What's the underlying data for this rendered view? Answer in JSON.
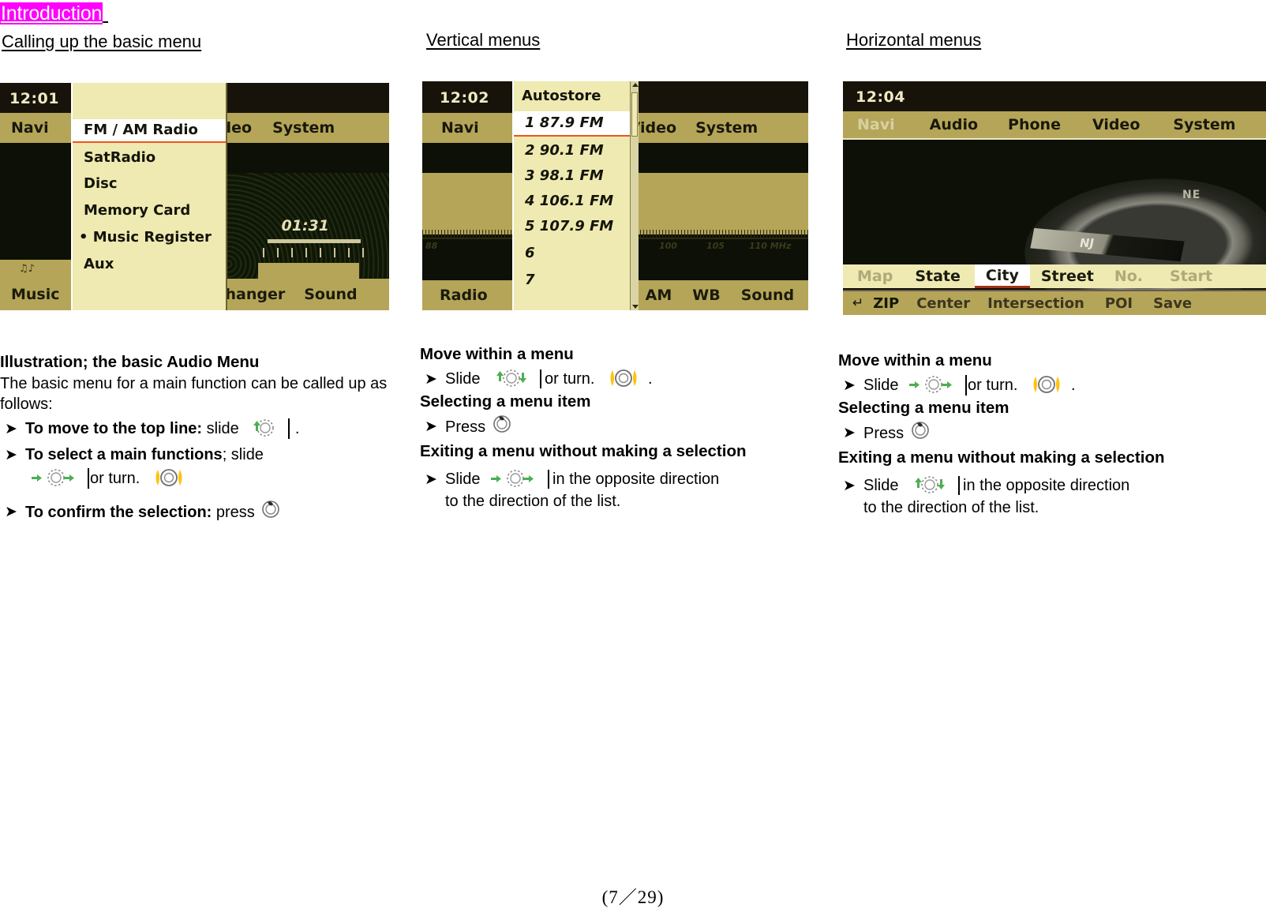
{
  "document": {
    "title": "Introduction",
    "page_number": "(7／29)"
  },
  "columns": {
    "left_heading": "Calling up the basic menu",
    "middle_heading": "Vertical menus",
    "right_heading": "Horizontal menus"
  },
  "screenshot_basic_menu": {
    "clock": "12:01",
    "menu_bar": [
      "Navi",
      "Video",
      "System"
    ],
    "dropdown_items": [
      "FM / AM Radio",
      "SatRadio",
      "Disc",
      "Memory Card",
      "• Music Register",
      "Aux"
    ],
    "selected_item": "FM / AM Radio",
    "track_time": "01:31",
    "foot_bar": [
      "Music ",
      "Changer",
      "Sound"
    ]
  },
  "screenshot_vertical_menu": {
    "clock": "12:02",
    "menu_bar": [
      "Navi",
      "Video",
      "System"
    ],
    "dropdown_title": "Autostore",
    "dropdown_items": [
      "1 87.9 FM",
      "2 90.1 FM",
      "3 98.1 FM",
      "4 106.1 FM",
      "5 107.9 FM",
      "6",
      "7"
    ],
    "selected_item": "1 87.9 FM",
    "scale_labels": [
      "88",
      "100",
      "105",
      "110 MHz"
    ],
    "foot_bar": [
      "Radio",
      "AM",
      "WB",
      "Sound"
    ]
  },
  "screenshot_horizontal_menu": {
    "clock": "12:04",
    "menu_bar": [
      "Navi",
      "Audio",
      "Phone",
      "Video",
      "System"
    ],
    "compass_labels": [
      "NE",
      "NJ"
    ],
    "tab_row": [
      "Map",
      "State",
      "City",
      "Street",
      "No.",
      "Start"
    ],
    "selected_tab": "City",
    "sub_row": [
      "ZIP",
      "Center",
      "Intersection",
      "POI",
      "Save"
    ],
    "back_icon": "back-arrow-icon"
  },
  "left_column": {
    "heading": "Illustration; the basic Audio Menu",
    "intro": "The basic menu for a main function can be called up as follows:",
    "bullets": [
      {
        "bold": "To move to the top line:",
        "rest": "slide",
        "trailing": "."
      },
      {
        "bold": "To select a main functions",
        "rest": "; slide",
        "cont_text": "or turn."
      },
      {
        "bold": "To confirm the selection:",
        "rest": "press",
        "trailing": ""
      }
    ]
  },
  "middle_column": {
    "heading_1": "Move within a menu",
    "slide_label": "Slide",
    "or_turn_label": "or turn.",
    "period": ".",
    "heading_2": "Selecting a menu item",
    "press_label": "Press",
    "heading_3": "Exiting a menu without making a selection",
    "exit_text_line1": "in the opposite direction",
    "exit_text_line2": "to the direction of the list."
  },
  "right_column": {
    "heading_1": "Move within a menu",
    "slide_label": "Slide",
    "or_turn_label": "or turn.",
    "period": ".",
    "heading_2": "Selecting a menu item",
    "press_label": "Press",
    "heading_3": "Exiting a menu without making a selection",
    "exit_text_line1": "in the opposite direction",
    "exit_text_line2": "to the direction of the list."
  },
  "icons": {
    "bullet_arrow": "➤",
    "controller_updown": "controller-slide-updown-icon",
    "controller_leftright": "controller-slide-leftright-icon",
    "controller_turn": "controller-turn-icon",
    "controller_press": "controller-press-icon"
  },
  "colors": {
    "highlight": "#FF00FF",
    "ui_beige": "#b5a558",
    "ui_cream": "#eeeab2",
    "ui_dark": "#0c1006",
    "selection_underline": "#f0541e",
    "arrow_green": "#4caf50",
    "arrow_yellow": "#ffc20e"
  }
}
